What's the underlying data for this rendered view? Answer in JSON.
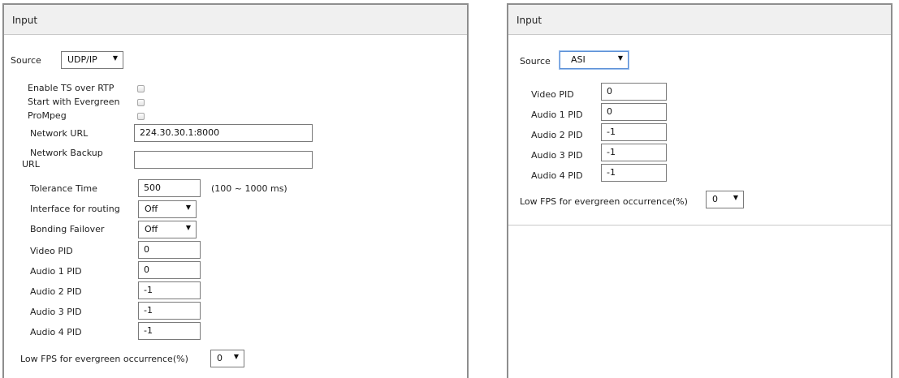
{
  "left": {
    "title": "Input",
    "source_label": "Source",
    "source_value": "UDP/IP",
    "enable_ts_rtp_label": "Enable TS over RTP",
    "start_evergreen_label": "Start with Evergreen",
    "prompeg_label": "ProMpeg",
    "network_url_label": "Network URL",
    "network_url_value": "224.30.30.1:8000",
    "network_backup_label_line1": "Network Backup",
    "network_backup_label_line2": "URL",
    "network_backup_value": "",
    "tolerance_label": "Tolerance Time",
    "tolerance_value": "500",
    "tolerance_hint": "(100 ~ 1000 ms)",
    "interface_routing_label": "Interface for routing",
    "interface_routing_value": "Off",
    "bonding_failover_label": "Bonding Failover",
    "bonding_failover_value": "Off",
    "video_pid_label": "Video PID",
    "video_pid_value": "0",
    "audio1_pid_label": "Audio 1 PID",
    "audio1_pid_value": "0",
    "audio2_pid_label": "Audio 2 PID",
    "audio2_pid_value": "-1",
    "audio3_pid_label": "Audio 3 PID",
    "audio3_pid_value": "-1",
    "audio4_pid_label": "Audio 4 PID",
    "audio4_pid_value": "-1",
    "low_fps_label": "Low FPS for evergreen occurrence(%)",
    "low_fps_value": "0"
  },
  "right": {
    "title": "Input",
    "source_label": "Source",
    "source_value": "ASI",
    "video_pid_label": "Video PID",
    "video_pid_value": "0",
    "audio1_pid_label": "Audio 1 PID",
    "audio1_pid_value": "0",
    "audio2_pid_label": "Audio 2 PID",
    "audio2_pid_value": "-1",
    "audio3_pid_label": "Audio 3 PID",
    "audio3_pid_value": "-1",
    "audio4_pid_label": "Audio 4 PID",
    "audio4_pid_value": "-1",
    "low_fps_label": "Low FPS for evergreen occurrence(%)",
    "low_fps_value": "0"
  },
  "icons": {
    "dropdown_arrow": "▼"
  }
}
